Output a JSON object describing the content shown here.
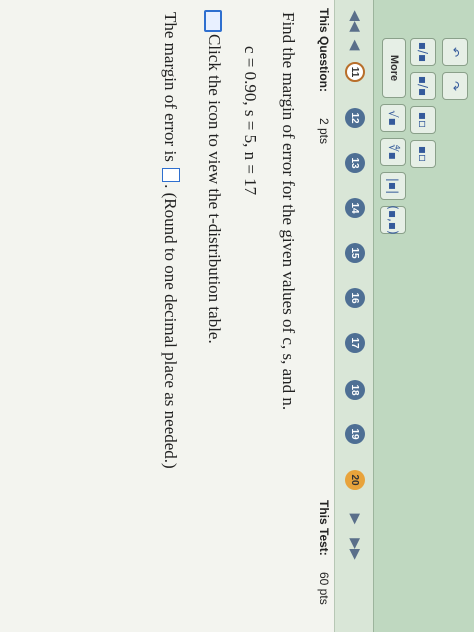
{
  "toolbar": {
    "rows": [
      [
        "↶",
        "↷"
      ],
      [
        "▪/▪",
        "▪/▪",
        "▪▫",
        "▪▫"
      ],
      [
        "√▪",
        "∜▪",
        "|▪|",
        "(▪,▪)"
      ]
    ],
    "more_label": "More"
  },
  "nav": {
    "first": "◀◀",
    "prev": "◀",
    "questions": [
      "11",
      "12",
      "13",
      "14",
      "15",
      "16",
      "17",
      "18",
      "19",
      "20"
    ],
    "current_index": 0,
    "flagged_index": 9,
    "next": "▶",
    "last": "▶▶"
  },
  "header": {
    "this_question_label": "This Question:",
    "question_points": "2 pts",
    "this_test_label": "This Test:",
    "test_points": "60 pts"
  },
  "question": {
    "prompt": "Find the margin of error for the given values of c, s, and n.",
    "values": "c = 0.90, s = 5, n = 17",
    "table_link": "Click the icon to view the t-distribution table.",
    "answer_prefix": "The margin of error is",
    "answer_suffix": ". (Round to one decimal place as needed.)"
  }
}
